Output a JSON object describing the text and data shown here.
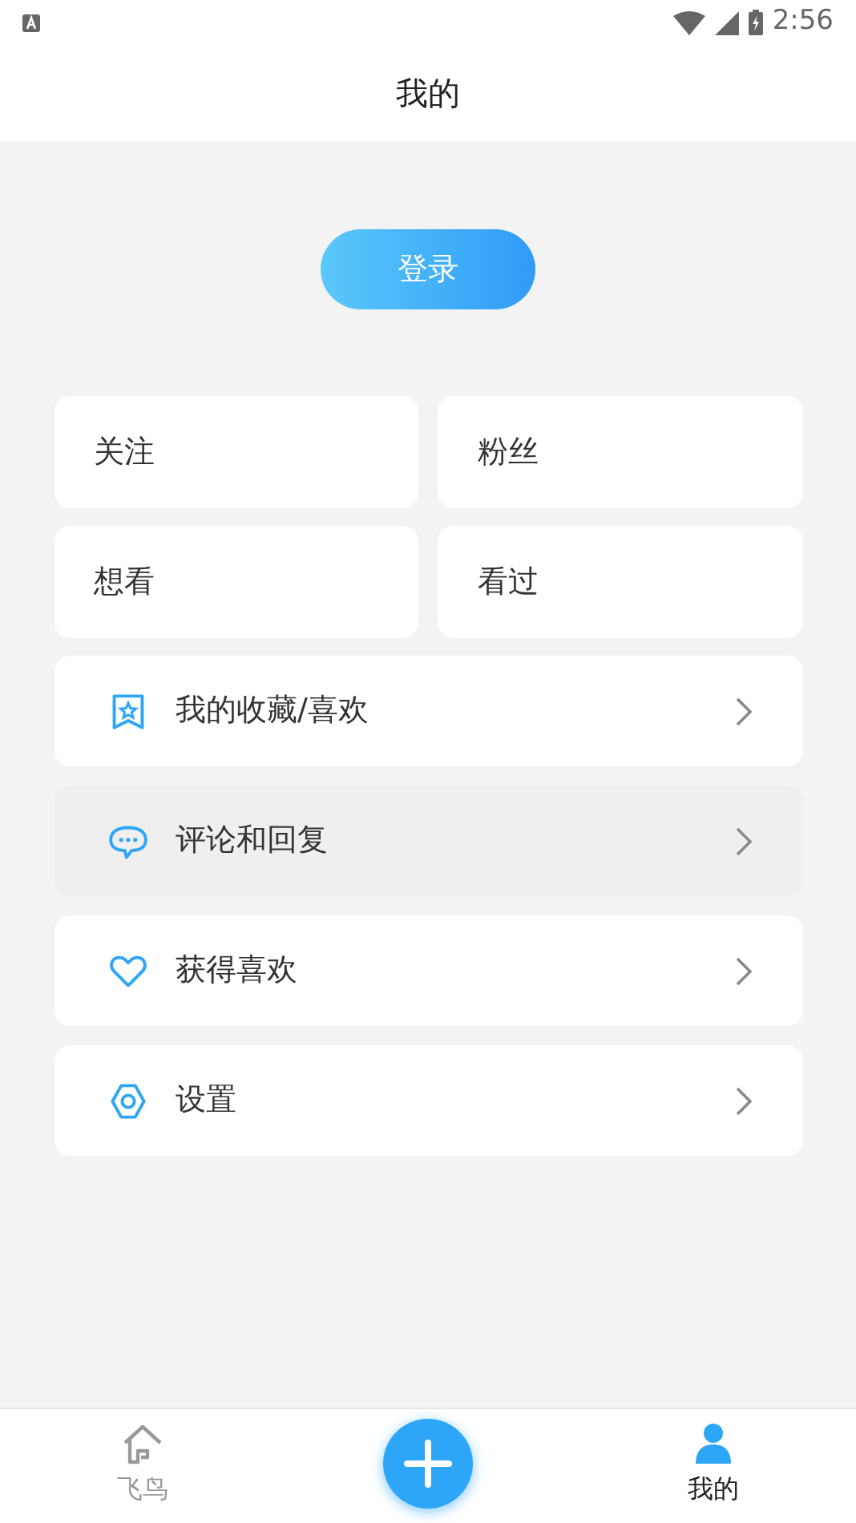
{
  "status_bar": {
    "time": "2:56"
  },
  "header": {
    "title": "我的"
  },
  "login_button": "登录",
  "stats": [
    {
      "label": "关注"
    },
    {
      "label": "粉丝"
    },
    {
      "label": "想看"
    },
    {
      "label": "看过"
    }
  ],
  "menu": [
    {
      "kind": "favorites",
      "label": "我的收藏/喜欢",
      "pressed": false
    },
    {
      "kind": "comments",
      "label": "评论和回复",
      "pressed": true
    },
    {
      "kind": "likes",
      "label": "获得喜欢",
      "pressed": false
    },
    {
      "kind": "settings",
      "label": "设置",
      "pressed": false
    }
  ],
  "bottom_nav": [
    {
      "kind": "home",
      "label": "飞鸟",
      "selected": false
    },
    {
      "kind": "add"
    },
    {
      "kind": "profile",
      "label": "我的",
      "selected": true
    }
  ]
}
